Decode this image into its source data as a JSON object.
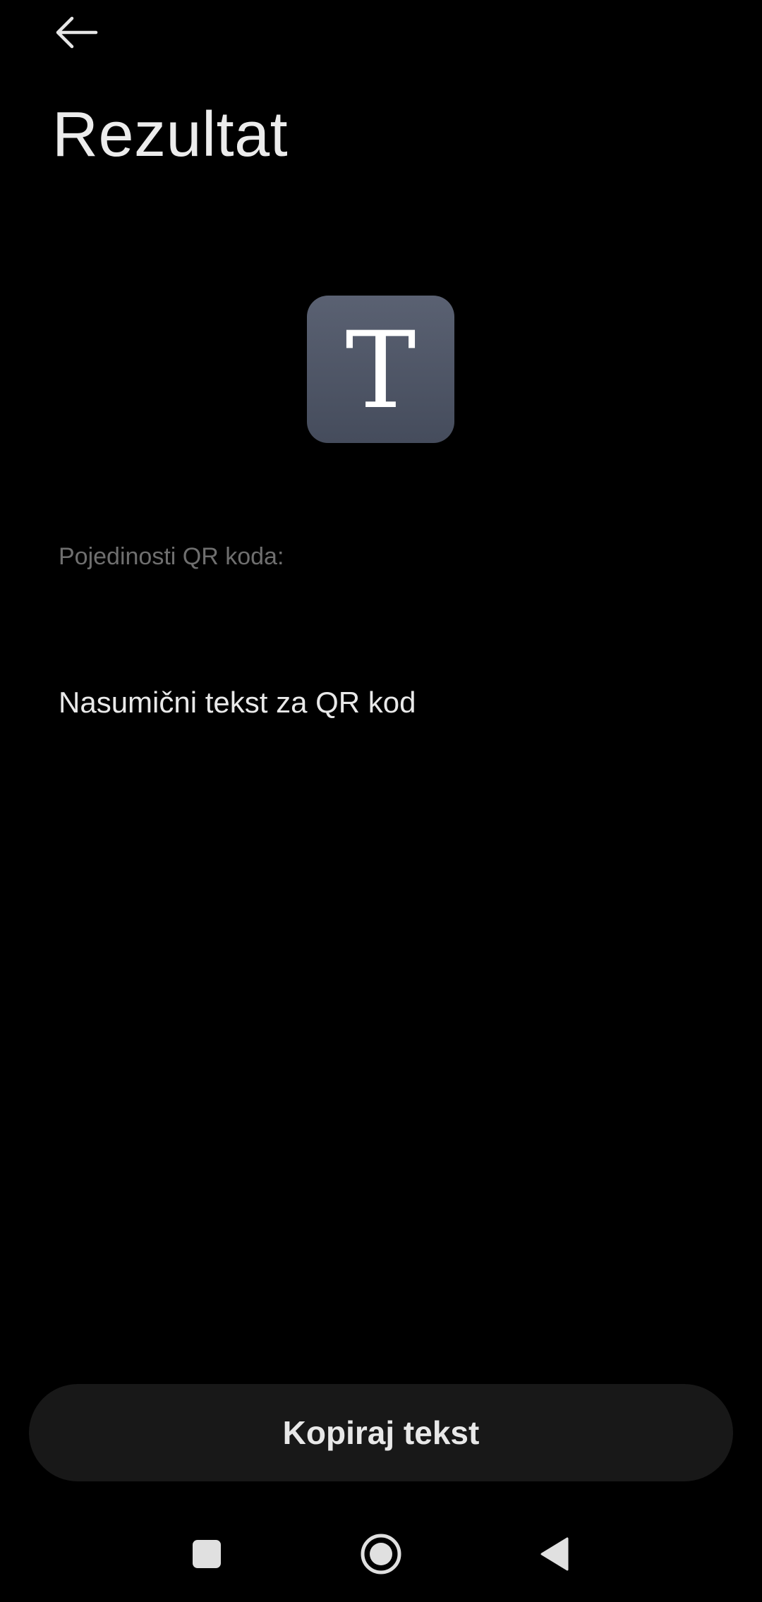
{
  "header": {
    "back_icon": "arrow-left-icon",
    "title": "Rezultat"
  },
  "result": {
    "type_icon": "text-type-icon",
    "type_letter": "T",
    "details_label": "Pojedinosti QR koda:",
    "details_value": "Nasumični tekst za QR kod"
  },
  "actions": {
    "copy_label": "Kopiraj tekst"
  },
  "system_nav": {
    "recents_icon": "square-icon",
    "home_icon": "circle-icon",
    "back_icon": "triangle-back-icon"
  },
  "colors": {
    "background": "#000000",
    "icon_tile": "#4f5666",
    "button_background": "#181818",
    "secondary_text": "#6f6f6f"
  }
}
